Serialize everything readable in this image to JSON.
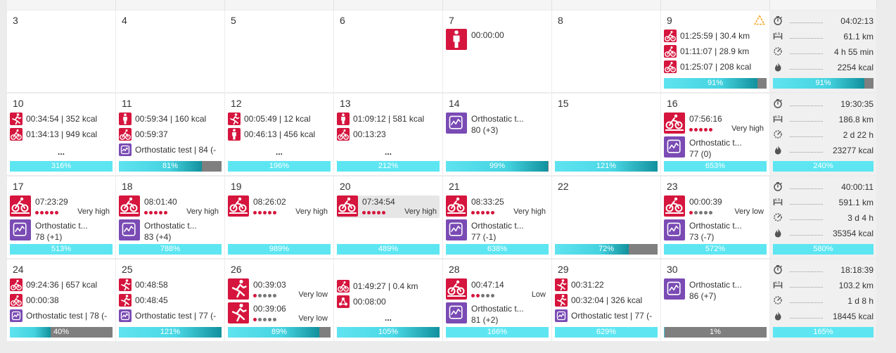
{
  "colors": {
    "activity_red": "#d5153d",
    "test_purple": "#7a4bb4",
    "bar_cyan": "#5de6f2",
    "bar_teal": "#12919d",
    "bar_gray": "#7f7f7f",
    "warning_orange": "#f5a623"
  },
  "weeks": [
    {
      "days": [
        {
          "num": "3",
          "items": [],
          "progress": null
        },
        {
          "num": "4",
          "items": [],
          "progress": null
        },
        {
          "num": "5",
          "items": [],
          "progress": null
        },
        {
          "num": "6",
          "items": [],
          "progress": null
        },
        {
          "num": "7",
          "items": [
            {
              "size": "lg",
              "icon": "standing-person-icon",
              "color": "red",
              "text": "00:00:00"
            }
          ],
          "progress": null
        },
        {
          "num": "8",
          "items": [],
          "progress": null
        },
        {
          "num": "9",
          "warning": true,
          "items": [
            {
              "size": "sm",
              "icon": "cycling-icon",
              "color": "red",
              "text": "01:25:59 | 30.4 km"
            },
            {
              "size": "sm",
              "icon": "cycling-icon",
              "color": "red",
              "text": "01:11:07 | 28.9 km"
            },
            {
              "size": "sm",
              "icon": "cycling-icon",
              "color": "red",
              "text": "01:25:07 | 208 kcal"
            }
          ],
          "progress": {
            "label": "91%",
            "value": 91
          }
        }
      ],
      "summary": {
        "duration": "04:02:13",
        "distance": "61.1 km",
        "recovery": "4 h 55 min",
        "calories": "2254 kcal",
        "progress": {
          "label": "91%",
          "value": 91
        }
      }
    },
    {
      "days": [
        {
          "num": "10",
          "items": [
            {
              "size": "sm",
              "icon": "running-icon",
              "color": "red",
              "text": "00:34:54 | 352 kcal"
            },
            {
              "size": "sm",
              "icon": "cycling-icon",
              "color": "red",
              "text": "01:34:13 | 949 kcal"
            }
          ],
          "more": "...",
          "progress": {
            "label": "316%",
            "value": 316
          }
        },
        {
          "num": "11",
          "items": [
            {
              "size": "sm",
              "icon": "standing-person-icon",
              "color": "red",
              "text": "00:59:34 | 160 kcal"
            },
            {
              "size": "sm",
              "icon": "cycling-icon",
              "color": "red",
              "text": "00:59:37"
            },
            {
              "size": "sm",
              "icon": "orthostatic-test-icon",
              "color": "purple",
              "text": "Orthostatic test | 84 (-"
            }
          ],
          "progress": {
            "label": "81%",
            "value": 81
          }
        },
        {
          "num": "12",
          "items": [
            {
              "size": "sm",
              "icon": "running-icon",
              "color": "red",
              "text": "00:05:49 | 12 kcal"
            },
            {
              "size": "sm",
              "icon": "standing-person-icon",
              "color": "red",
              "text": "00:46:13 | 456 kcal"
            }
          ],
          "more": "...",
          "progress": {
            "label": "196%",
            "value": 196
          }
        },
        {
          "num": "13",
          "items": [
            {
              "size": "sm",
              "icon": "standing-person-icon",
              "color": "red",
              "text": "01:09:12 | 581 kcal"
            },
            {
              "size": "sm",
              "icon": "cycling-icon",
              "color": "red",
              "text": "00:13:23"
            }
          ],
          "more": "...",
          "progress": {
            "label": "212%",
            "value": 212
          }
        },
        {
          "num": "14",
          "items": [
            {
              "size": "lg",
              "icon": "orthostatic-test-icon",
              "color": "purple",
              "text": "Orthostatic t...",
              "sub": "80 (+3)"
            }
          ],
          "progress": {
            "label": "99%",
            "value": 99
          }
        },
        {
          "num": "15",
          "items": [],
          "progress": {
            "label": "121%",
            "value": 121
          }
        },
        {
          "num": "16",
          "items": [
            {
              "size": "lg",
              "icon": "indoor-cycling-icon",
              "color": "red",
              "text": "07:56:16",
              "dots": 5,
              "intensity": "Very high"
            },
            {
              "size": "lg",
              "icon": "orthostatic-test-icon",
              "color": "purple",
              "text": "Orthostatic t...",
              "sub": "77 (0)"
            }
          ],
          "progress": {
            "label": "653%",
            "value": 653
          }
        }
      ],
      "summary": {
        "duration": "19:30:35",
        "distance": "186.8 km",
        "recovery": "2 d 22 h",
        "calories": "23277 kcal",
        "progress": {
          "label": "240%",
          "value": 240
        }
      }
    },
    {
      "days": [
        {
          "num": "17",
          "items": [
            {
              "size": "lg",
              "icon": "indoor-cycling-icon",
              "color": "red",
              "text": "07:23:29",
              "dots": 5,
              "intensity": "Very high"
            },
            {
              "size": "lg",
              "icon": "orthostatic-test-icon",
              "color": "purple",
              "text": "Orthostatic t...",
              "sub": "78 (+1)"
            }
          ],
          "progress": {
            "label": "513%",
            "value": 513
          }
        },
        {
          "num": "18",
          "items": [
            {
              "size": "lg",
              "icon": "indoor-cycling-icon",
              "color": "red",
              "text": "08:01:40",
              "dots": 5,
              "intensity": "Very high"
            },
            {
              "size": "lg",
              "icon": "orthostatic-test-icon",
              "color": "purple",
              "text": "Orthostatic t...",
              "sub": "83 (+4)"
            }
          ],
          "progress": {
            "label": "788%",
            "value": 788
          }
        },
        {
          "num": "19",
          "items": [
            {
              "size": "lg",
              "icon": "indoor-cycling-icon",
              "color": "red",
              "text": "08:26:02",
              "dots": 5,
              "intensity": "Very high"
            }
          ],
          "progress": {
            "label": "989%",
            "value": 989
          }
        },
        {
          "num": "20",
          "items": [
            {
              "size": "lg",
              "icon": "indoor-cycling-icon",
              "color": "red",
              "text": "07:34:54",
              "dots": 5,
              "intensity": "Very high",
              "highlight": true
            }
          ],
          "progress": {
            "label": "489%",
            "value": 489
          }
        },
        {
          "num": "21",
          "items": [
            {
              "size": "lg",
              "icon": "indoor-cycling-icon",
              "color": "red",
              "text": "08:33:25",
              "dots": 5,
              "intensity": "Very high"
            },
            {
              "size": "lg",
              "icon": "orthostatic-test-icon",
              "color": "purple",
              "text": "Orthostatic t...",
              "sub": "77 (-1)"
            }
          ],
          "progress": {
            "label": "638%",
            "value": 638
          }
        },
        {
          "num": "22",
          "items": [],
          "progress": {
            "label": "72%",
            "value": 72
          }
        },
        {
          "num": "23",
          "items": [
            {
              "size": "lg",
              "icon": "indoor-cycling-icon",
              "color": "red",
              "text": "00:00:39",
              "dots": 1,
              "intensity": "Very low"
            },
            {
              "size": "lg",
              "icon": "orthostatic-test-icon",
              "color": "purple",
              "text": "Orthostatic t...",
              "sub": "73 (-7)"
            }
          ],
          "progress": {
            "label": "572%",
            "value": 572
          }
        }
      ],
      "summary": {
        "duration": "40:00:11",
        "distance": "591.1 km",
        "recovery": "3 d 4 h",
        "calories": "35354 kcal",
        "progress": {
          "label": "580%",
          "value": 580
        }
      }
    },
    {
      "days": [
        {
          "num": "24",
          "items": [
            {
              "size": "sm",
              "icon": "cycling-icon",
              "color": "red",
              "text": "09:24:36 | 657 kcal"
            },
            {
              "size": "sm",
              "icon": "cycling-icon",
              "color": "red",
              "text": "00:00:38"
            },
            {
              "size": "sm",
              "icon": "orthostatic-test-icon",
              "color": "purple",
              "text": "Orthostatic test | 78 (-"
            }
          ],
          "progress": {
            "label": "40%",
            "value": 40
          }
        },
        {
          "num": "25",
          "items": [
            {
              "size": "sm",
              "icon": "running-icon",
              "color": "red",
              "text": "00:48:58"
            },
            {
              "size": "sm",
              "icon": "running-icon",
              "color": "red",
              "text": "00:48:45"
            },
            {
              "size": "sm",
              "icon": "orthostatic-test-icon",
              "color": "purple",
              "text": "Orthostatic test | 77 (-"
            }
          ],
          "progress": {
            "label": "121%",
            "value": 121
          }
        },
        {
          "num": "26",
          "items": [
            {
              "size": "lg",
              "icon": "running-icon",
              "color": "red",
              "text": "00:39:03",
              "dots": 1,
              "intensity": "Very low"
            },
            {
              "size": "lg",
              "icon": "running-icon",
              "color": "red",
              "text": "00:39:06",
              "dots": 1,
              "intensity": "Very low"
            }
          ],
          "progress": {
            "label": "89%",
            "value": 89
          }
        },
        {
          "num": "",
          "items": [
            {
              "size": "sm",
              "icon": "cycling-icon",
              "color": "red",
              "text": "01:49:27 | 0.4 km"
            },
            {
              "size": "sm",
              "icon": "other-sport-icon",
              "color": "red",
              "text": "00:08:00"
            }
          ],
          "more": "...",
          "progress": {
            "label": "105%",
            "value": 105
          }
        },
        {
          "num": "28",
          "items": [
            {
              "size": "lg",
              "icon": "indoor-cycling-icon",
              "color": "red",
              "text": "00:47:14",
              "dots": 2,
              "intensity": "Low"
            },
            {
              "size": "lg",
              "icon": "orthostatic-test-icon",
              "color": "purple",
              "text": "Orthostatic t...",
              "sub": "81 (+2)"
            }
          ],
          "progress": {
            "label": "166%",
            "value": 166
          }
        },
        {
          "num": "29",
          "items": [
            {
              "size": "sm",
              "icon": "running-icon",
              "color": "red",
              "text": "00:31:22"
            },
            {
              "size": "sm",
              "icon": "running-icon",
              "color": "red",
              "text": "00:32:04 | 326 kcal"
            },
            {
              "size": "sm",
              "icon": "orthostatic-test-icon",
              "color": "purple",
              "text": "Orthostatic test | 77 (-"
            }
          ],
          "progress": {
            "label": "629%",
            "value": 629
          }
        },
        {
          "num": "30",
          "items": [
            {
              "size": "lg",
              "icon": "orthostatic-test-icon",
              "color": "purple",
              "text": "Orthostatic t...",
              "sub": "86 (+7)"
            }
          ],
          "progress": {
            "label": "1%",
            "value": 1
          }
        }
      ],
      "summary": {
        "duration": "18:18:39",
        "distance": "103.2 km",
        "recovery": "1 d 8 h",
        "calories": "18445 kcal",
        "progress": {
          "label": "165%",
          "value": 165
        }
      }
    }
  ]
}
